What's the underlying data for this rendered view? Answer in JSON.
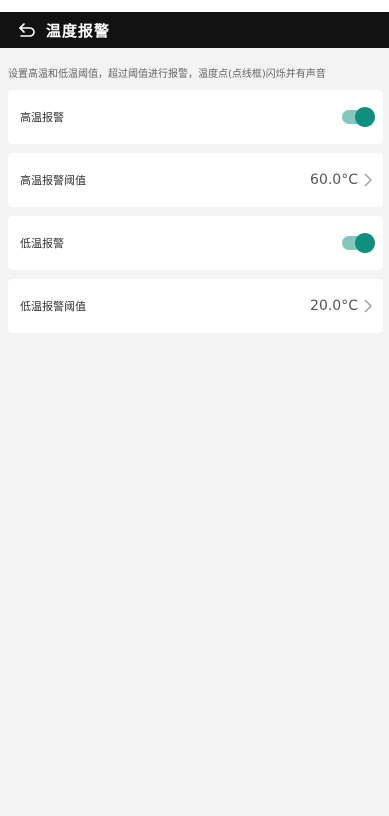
{
  "header": {
    "title": "温度报警",
    "back_icon": "back-arrow-icon"
  },
  "hint": "设置高温和低温阈值，超过阈值进行报警，温度点(点线框)闪烁并有声音",
  "rows": [
    {
      "label": "高温报警",
      "type": "toggle",
      "enabled": true
    },
    {
      "label": "高温报警阈值",
      "type": "value",
      "value": "60.0°C"
    },
    {
      "label": "低温报警",
      "type": "toggle",
      "enabled": true
    },
    {
      "label": "低温报警阈值",
      "type": "value",
      "value": "20.0°C"
    }
  ],
  "colors": {
    "header_bg": "#121212",
    "accent": "#0f8f7d",
    "toggle_track": "#84c7bd",
    "page_bg": "#f3f3f3"
  }
}
